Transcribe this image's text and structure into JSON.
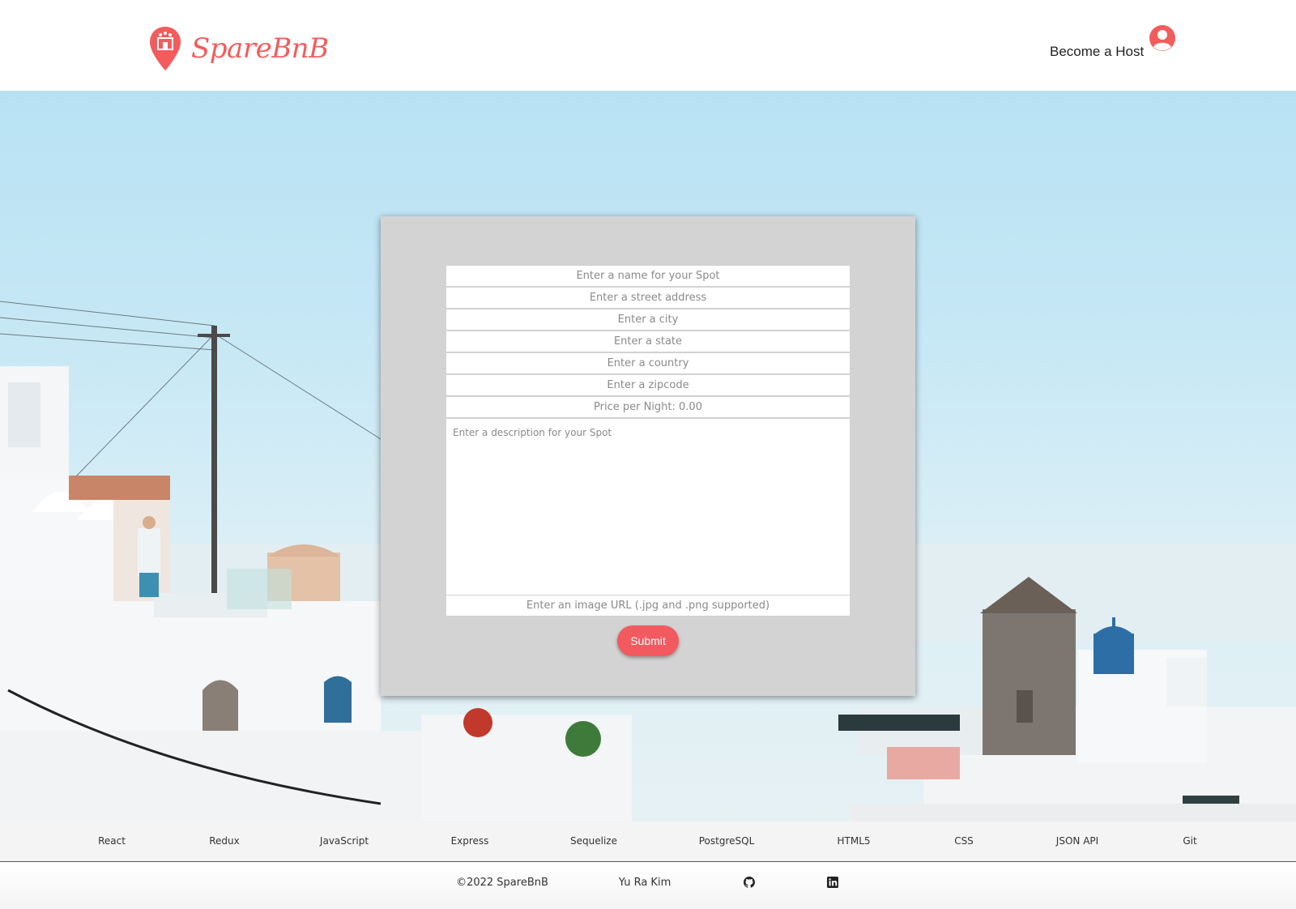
{
  "brand": {
    "name": "SpareBnB",
    "accent": "#f25c5c"
  },
  "nav": {
    "host_label": "Become a Host",
    "profile_icon": "user-circle-icon"
  },
  "form": {
    "name_placeholder": "Enter a name for your Spot",
    "address_placeholder": "Enter a street address",
    "city_placeholder": "Enter a city",
    "state_placeholder": "Enter a state",
    "country_placeholder": "Enter a country",
    "zipcode_placeholder": "Enter a zipcode",
    "price_placeholder": "Price per Night: 0.00",
    "description_placeholder": "Enter a description for your Spot",
    "image_placeholder": "Enter an image URL (.jpg and .png supported)",
    "submit_label": "Submit",
    "submit_color": "#f35a5f"
  },
  "tech_stack": [
    "React",
    "Redux",
    "JavaScript",
    "Express",
    "Sequelize",
    "PostgreSQL",
    "HTML5",
    "CSS",
    "JSON API",
    "Git"
  ],
  "footer": {
    "copyright": "©2022 SpareBnB",
    "author": "Yu Ra Kim",
    "github_icon": "github-icon",
    "linkedin_icon": "linkedin-icon"
  }
}
